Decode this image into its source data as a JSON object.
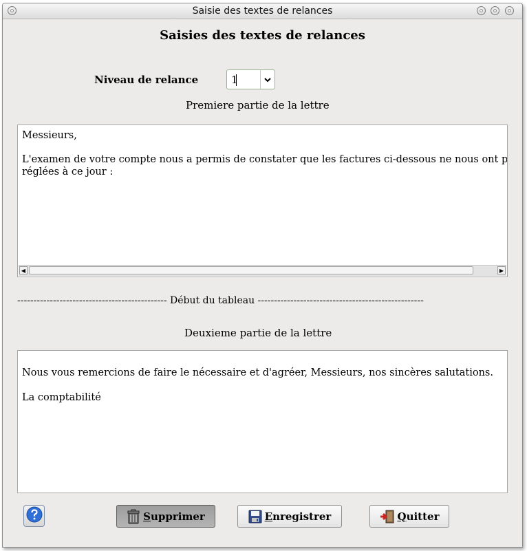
{
  "window": {
    "title": "Saisie des textes de relances"
  },
  "form": {
    "heading": "Saisies des textes de relances",
    "niveau_label": "Niveau de relance",
    "niveau_value": "1",
    "part1_label": "Premiere partie de la lettre",
    "part1_line1": "Messieurs,",
    "part1_line2": "",
    "part1_line3": "L'examen de votre compte nous a permis de constater que les factures ci-dessous ne nous ont pas",
    "part1_line4": "réglées à ce jour :",
    "separator": "---------------------------------------------- Début du tableau ---------------------------------------------------",
    "part2_label": "Deuxieme partie de la lettre",
    "part2_line1": "Nous vous remercions de faire le nécessaire et d'agréer, Messieurs, nos sincères salutations.",
    "part2_line2": "",
    "part2_line3": "La comptabilité"
  },
  "buttons": {
    "supprimer": "Supprimer",
    "enregistrer": "Enregistrer",
    "quitter": "Quitter"
  },
  "icons": {
    "help": "help-icon",
    "trash": "trash-icon",
    "save": "floppy-disk-icon",
    "quit": "exit-door-icon",
    "dropdown": "chevron-down-icon"
  },
  "colors": {
    "window_bg": "#ecebe9",
    "help_blue": "#2f6fd8",
    "save_blue": "#334d8c",
    "quit_red": "#d02020"
  }
}
